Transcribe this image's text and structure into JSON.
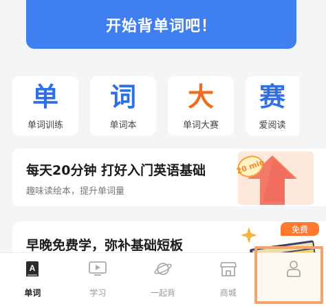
{
  "header": {
    "start_button": "开始背单词吧！"
  },
  "features": [
    {
      "glyph": "单",
      "label": "单词训练",
      "color": "#2f6fe4"
    },
    {
      "glyph": "词",
      "label": "单词本",
      "color": "#2f6fe4"
    },
    {
      "glyph": "大",
      "label": "单词大赛",
      "color": "#f26b1d"
    },
    {
      "glyph": "赛",
      "label": "爱阅读",
      "color": "#2f6fe4"
    }
  ],
  "cards": [
    {
      "title": "每天20分钟 打好入门英语基础",
      "subtitle": "趣味读绘本，提升单词量",
      "art_text": "20 min"
    },
    {
      "title": "早晚免费学，弥补基础短板",
      "badge": "免费"
    }
  ],
  "tabbar": [
    {
      "label": "单词",
      "icon": "book-a-icon",
      "active": true
    },
    {
      "label": "学习",
      "icon": "video-play-icon",
      "active": false
    },
    {
      "label": "一起背",
      "icon": "planet-icon",
      "active": false
    },
    {
      "label": "商城",
      "icon": "store-icon",
      "active": false
    },
    {
      "label": "",
      "icon": "user-icon",
      "active": false
    }
  ],
  "colors": {
    "primary": "#3f7ff0",
    "accent_orange": "#f26b1d",
    "highlight_border": "#f3a46c"
  }
}
